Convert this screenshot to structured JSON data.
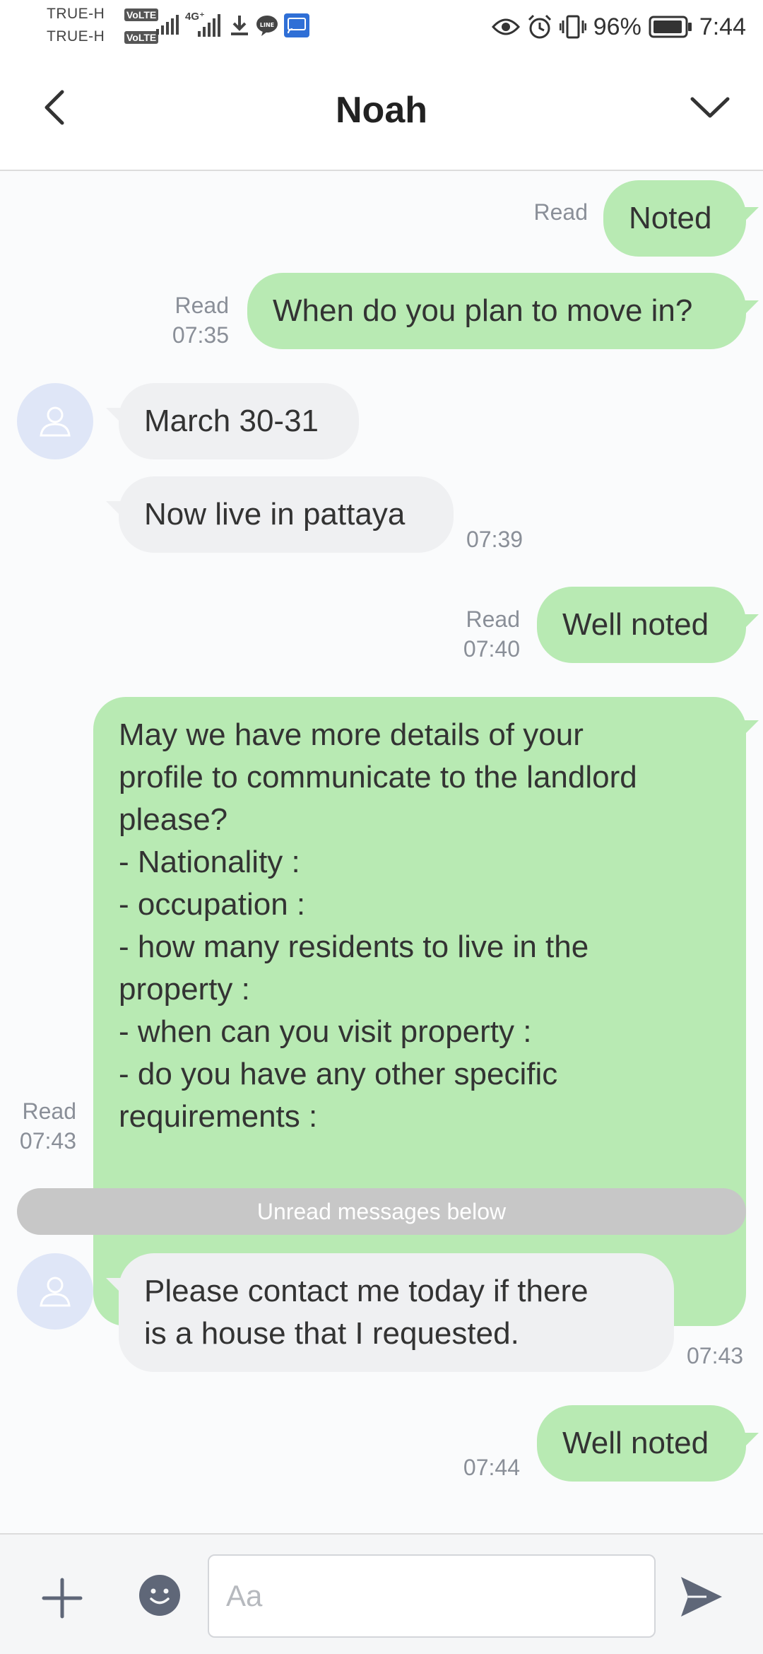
{
  "status_bar": {
    "carrier_1": "TRUE-H",
    "carrier_2": "TRUE-H",
    "volte_badge": "VoLTE",
    "network_label": "4G⁺",
    "battery_percent": "96%",
    "time": "7:44",
    "icons": [
      "signal-icon",
      "signal-4g-icon",
      "download-icon",
      "line-icon",
      "cast-icon",
      "eye-icon",
      "alarm-icon",
      "vibrate-icon",
      "battery-icon"
    ]
  },
  "header": {
    "title": "Noah"
  },
  "messages": [
    {
      "dir": "out",
      "text": "Noted",
      "status": "Read",
      "time": ""
    },
    {
      "dir": "out",
      "text": "When do you plan to move in?",
      "status": "Read",
      "time": "07:35"
    },
    {
      "dir": "in",
      "text": "March 30-31",
      "time": ""
    },
    {
      "dir": "in",
      "text": "Now live in pattaya",
      "time": "07:39"
    },
    {
      "dir": "out",
      "text": "Well noted",
      "status": "Read",
      "time": "07:40"
    },
    {
      "dir": "out",
      "text": "May we have more details of your\nprofile to communicate to the landlord\nplease?\n- Nationality :\n- occupation :\n- how many residents to live in the\nproperty :\n- when can you visit property :\n- do you have any other specific\nrequirements :",
      "status": "Read",
      "time": "07:43"
    },
    {
      "dir": "in",
      "text": "Please contact me today if there\nis a house that I requested.",
      "time": "07:43"
    },
    {
      "dir": "out",
      "text": "Well noted",
      "status": "",
      "time": "07:44"
    }
  ],
  "unread_divider": "Unread messages below",
  "input": {
    "placeholder": "Aa",
    "value": ""
  },
  "colors": {
    "outgoing_bubble": "#b8eab3",
    "incoming_bubble": "#eff0f2",
    "avatar_bg": "#dfe6f7",
    "icon_gray": "#5f6778"
  }
}
